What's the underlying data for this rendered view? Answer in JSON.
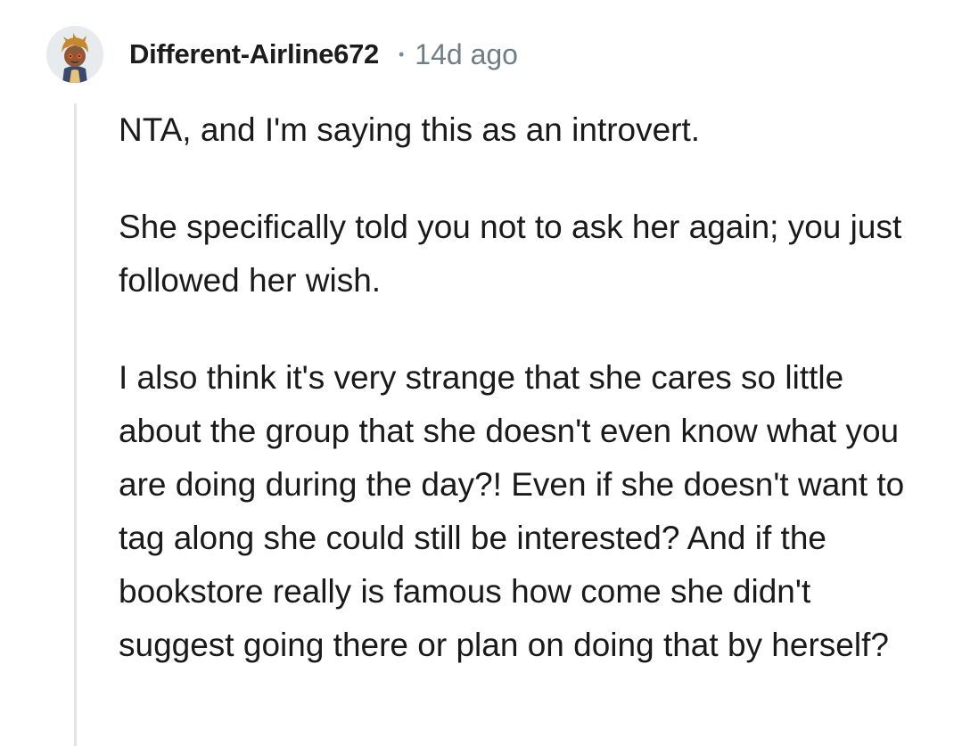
{
  "comment": {
    "author": "Different-Airline672",
    "separator": "•",
    "age": "14d ago",
    "paragraphs": [
      "NTA, and I'm saying this as an introvert.",
      "She specifically told you not to ask her again; you just followed her wish.",
      "I also think it's very strange that she cares so little about the group that she doesn't even know what you are doing during the day?! Even if she doesn't want to tag along she could still be interested? And if the bookstore really is famous how come she didn't suggest going there or plan on doing that by herself?"
    ]
  },
  "icons": {
    "avatar": "user-avatar-icon"
  }
}
